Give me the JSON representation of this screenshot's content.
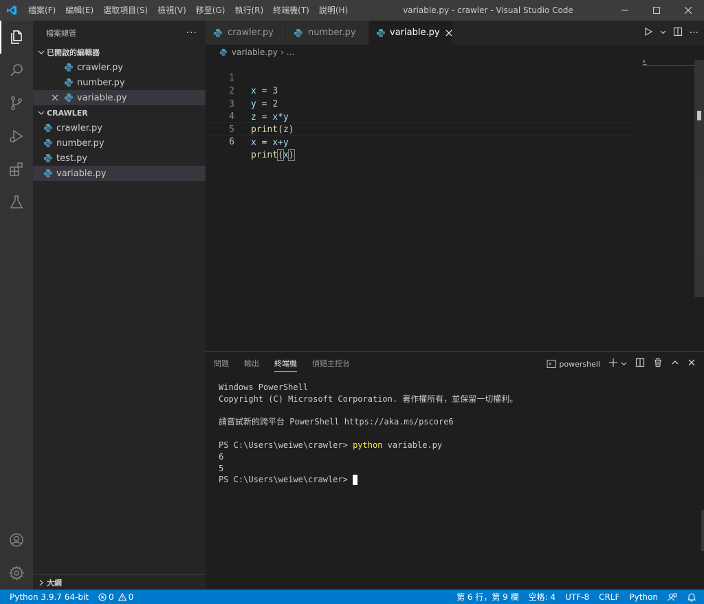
{
  "window": {
    "title": "variable.py - crawler - Visual Studio Code"
  },
  "menu": [
    "檔案(F)",
    "編輯(E)",
    "選取項目(S)",
    "檢視(V)",
    "移至(G)",
    "執行(R)",
    "終端機(T)",
    "說明(H)"
  ],
  "sidebar": {
    "title": "檔案總管",
    "more": "···",
    "open_editors": {
      "label": "已開啟的編輯器",
      "items": [
        "crawler.py",
        "number.py",
        "variable.py"
      ]
    },
    "folder": {
      "label": "CRAWLER",
      "items": [
        "crawler.py",
        "number.py",
        "test.py",
        "variable.py"
      ]
    },
    "outline": {
      "label": "大綱"
    }
  },
  "tabs": [
    {
      "label": "crawler.py"
    },
    {
      "label": "number.py"
    },
    {
      "label": "variable.py"
    }
  ],
  "breadcrumb": {
    "file": "variable.py",
    "separator": "›",
    "rest": "..."
  },
  "code": {
    "lines": [
      {
        "num": "1"
      },
      {
        "num": "2"
      },
      {
        "num": "3"
      },
      {
        "num": "4"
      },
      {
        "num": "5"
      },
      {
        "num": "6"
      }
    ],
    "tokens": {
      "l1": [
        "x",
        " = ",
        "3"
      ],
      "l2": [
        "y",
        " = ",
        "2"
      ],
      "l3": [
        "z",
        " = ",
        "x",
        "*",
        "y"
      ],
      "l4": [
        "print",
        "(",
        "z",
        ")"
      ],
      "l5": [
        "x",
        " = ",
        "x",
        "+",
        "y"
      ],
      "l6": [
        "print",
        "(",
        "x",
        ")"
      ]
    }
  },
  "panel": {
    "tabs": [
      "問題",
      "輸出",
      "終端機",
      "偵錯主控台"
    ],
    "terminal_name": "powershell",
    "terminal_lines": [
      "Windows PowerShell",
      "Copyright (C) Microsoft Corporation. 著作權所有，並保留一切權利。",
      "",
      "請嘗試新的跨平台 PowerShell https://aka.ms/pscore6",
      "",
      "PS C:\\Users\\weiwe\\crawler> ",
      "6",
      "5",
      "PS C:\\Users\\weiwe\\crawler> "
    ],
    "command": "python",
    "command_args": " variable.py"
  },
  "statusbar": {
    "python": "Python 3.9.7 64-bit",
    "errors": "0",
    "warnings": "0",
    "position": "第 6 行，第 9 欄",
    "spaces": "空格: 4",
    "encoding": "UTF-8",
    "eol": "CRLF",
    "language": "Python"
  },
  "colors": {
    "accent": "#007acc",
    "python_icon": "#519aba"
  }
}
